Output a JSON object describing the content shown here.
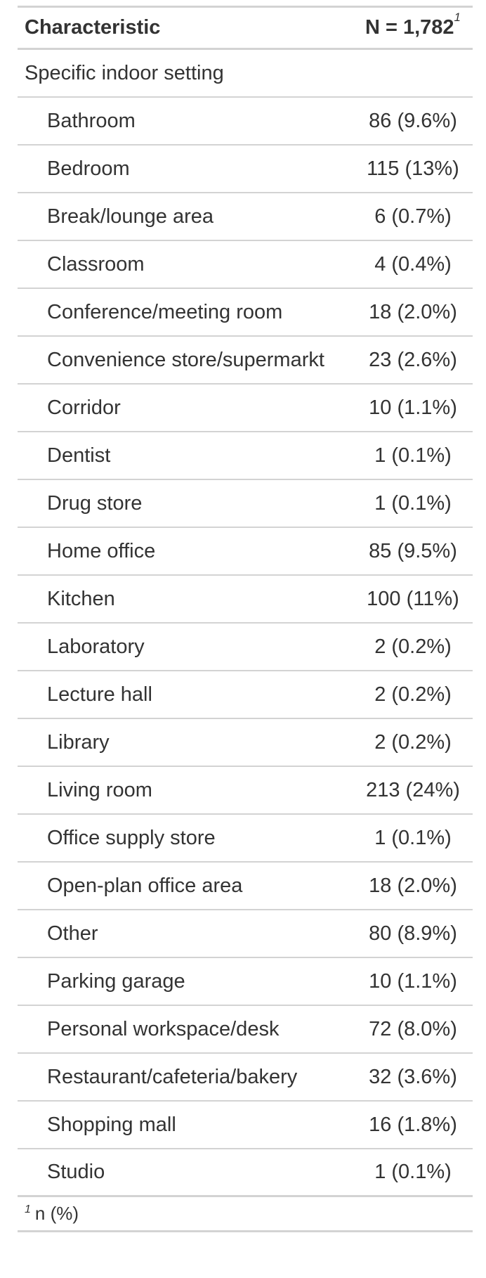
{
  "table": {
    "header": {
      "characteristic": "Characteristic",
      "n_label": "N = 1,782",
      "n_footnote_marker": "1"
    },
    "group_label": "Specific indoor setting",
    "rows": [
      {
        "label": "Bathroom",
        "value": "86 (9.6%)"
      },
      {
        "label": "Bedroom",
        "value": "115 (13%)"
      },
      {
        "label": "Break/lounge area",
        "value": "6 (0.7%)"
      },
      {
        "label": "Classroom",
        "value": "4 (0.4%)"
      },
      {
        "label": "Conference/meeting room",
        "value": "18 (2.0%)"
      },
      {
        "label": "Convenience store/supermarkt",
        "value": "23 (2.6%)"
      },
      {
        "label": "Corridor",
        "value": "10 (1.1%)"
      },
      {
        "label": "Dentist",
        "value": "1 (0.1%)"
      },
      {
        "label": "Drug store",
        "value": "1 (0.1%)"
      },
      {
        "label": "Home office",
        "value": "85 (9.5%)"
      },
      {
        "label": "Kitchen",
        "value": "100 (11%)"
      },
      {
        "label": "Laboratory",
        "value": "2 (0.2%)"
      },
      {
        "label": "Lecture hall",
        "value": "2 (0.2%)"
      },
      {
        "label": "Library",
        "value": "2 (0.2%)"
      },
      {
        "label": "Living room",
        "value": "213 (24%)"
      },
      {
        "label": "Office supply store",
        "value": "1 (0.1%)"
      },
      {
        "label": "Open-plan office area",
        "value": "18 (2.0%)"
      },
      {
        "label": "Other",
        "value": "80 (8.9%)"
      },
      {
        "label": "Parking garage",
        "value": "10 (1.1%)"
      },
      {
        "label": "Personal workspace/desk",
        "value": "72 (8.0%)"
      },
      {
        "label": "Restaurant/cafeteria/bakery",
        "value": "32 (3.6%)"
      },
      {
        "label": "Shopping mall",
        "value": "16 (1.8%)"
      },
      {
        "label": "Studio",
        "value": "1 (0.1%)"
      }
    ],
    "footnote": {
      "marker": "1",
      "text": "n (%)"
    }
  }
}
